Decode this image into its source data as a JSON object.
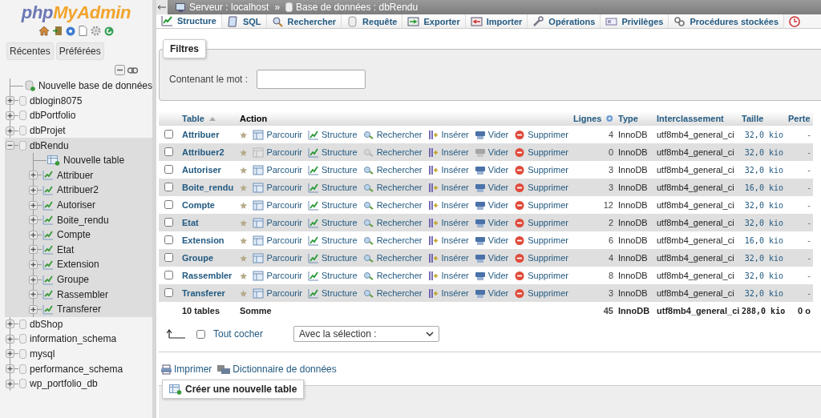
{
  "logo": [
    "php",
    "MyAdmin"
  ],
  "sidebar": {
    "tabs": [
      "Récentes",
      "Préférées"
    ],
    "tree": [
      {
        "label": "Nouvelle base de données",
        "kind": "new"
      },
      {
        "label": "dblogin8075",
        "kind": "db",
        "expanded": false,
        "selected": false
      },
      {
        "label": "dbPortfolio",
        "kind": "db",
        "expanded": false,
        "selected": false
      },
      {
        "label": "dbProjet",
        "kind": "db",
        "expanded": false,
        "selected": false
      },
      {
        "label": "dbRendu",
        "kind": "db",
        "expanded": true,
        "selected": true,
        "children": [
          {
            "label": "Nouvelle table",
            "kind": "new"
          },
          {
            "label": "Attribuer",
            "kind": "table",
            "expanded": false
          },
          {
            "label": "Attribuer2",
            "kind": "table",
            "expanded": false
          },
          {
            "label": "Autoriser",
            "kind": "table",
            "expanded": false
          },
          {
            "label": "Boite_rendu",
            "kind": "table",
            "expanded": false
          },
          {
            "label": "Compte",
            "kind": "table",
            "expanded": false
          },
          {
            "label": "Etat",
            "kind": "table",
            "expanded": false
          },
          {
            "label": "Extension",
            "kind": "table",
            "expanded": false
          },
          {
            "label": "Groupe",
            "kind": "table",
            "expanded": false
          },
          {
            "label": "Rassembler",
            "kind": "table",
            "expanded": false
          },
          {
            "label": "Transferer",
            "kind": "table",
            "expanded": false
          }
        ]
      },
      {
        "label": "dbShop",
        "kind": "db",
        "expanded": false,
        "selected": false
      },
      {
        "label": "information_schema",
        "kind": "db",
        "expanded": false,
        "selected": false
      },
      {
        "label": "mysql",
        "kind": "db",
        "expanded": false,
        "selected": false
      },
      {
        "label": "performance_schema",
        "kind": "db",
        "expanded": false,
        "selected": false
      },
      {
        "label": "wp_portfolio_db",
        "kind": "db",
        "expanded": false,
        "selected": false
      }
    ]
  },
  "breadcrumb": {
    "items": [
      "Serveur : localhost",
      "Base de données : dbRendu"
    ],
    "separator": "»"
  },
  "tabs": [
    {
      "label": "Structure",
      "selected": true
    },
    {
      "label": "SQL",
      "selected": false
    },
    {
      "label": "Rechercher",
      "selected": false
    },
    {
      "label": "Requête",
      "selected": false
    },
    {
      "label": "Exporter",
      "selected": false
    },
    {
      "label": "Importer",
      "selected": false
    },
    {
      "label": "Opérations",
      "selected": false
    },
    {
      "label": "Privilèges",
      "selected": false
    },
    {
      "label": "Procédures stockées",
      "selected": false
    }
  ],
  "filters": {
    "title": "Filtres",
    "label": "Contenant le mot :"
  },
  "table": {
    "columns": [
      "Table",
      "Action",
      "Lignes",
      "Type",
      "Interclassement",
      "Taille",
      "Perte"
    ],
    "rows": [
      {
        "name": "Attribuer",
        "checked": false,
        "empty": false,
        "actions": [
          "Parcourir",
          "Structure",
          "Rechercher",
          "Insérer",
          "Vider",
          "Supprimer"
        ],
        "rows": "4",
        "type": "InnoDB",
        "collation": "utf8mb4_general_ci",
        "size": "32,0 kio",
        "overhead": "-"
      },
      {
        "name": "Attribuer2",
        "checked": false,
        "empty": true,
        "actions": [
          "Parcourir",
          "Structure",
          "Rechercher",
          "Insérer",
          "Vider",
          "Supprimer"
        ],
        "rows": "0",
        "type": "InnoDB",
        "collation": "utf8mb4_general_ci",
        "size": "32,0 kio",
        "overhead": "-"
      },
      {
        "name": "Autoriser",
        "checked": false,
        "empty": false,
        "actions": [
          "Parcourir",
          "Structure",
          "Rechercher",
          "Insérer",
          "Vider",
          "Supprimer"
        ],
        "rows": "3",
        "type": "InnoDB",
        "collation": "utf8mb4_general_ci",
        "size": "32,0 kio",
        "overhead": "-"
      },
      {
        "name": "Boite_rendu",
        "checked": false,
        "empty": false,
        "actions": [
          "Parcourir",
          "Structure",
          "Rechercher",
          "Insérer",
          "Vider",
          "Supprimer"
        ],
        "rows": "3",
        "type": "InnoDB",
        "collation": "utf8mb4_general_ci",
        "size": "16,0 kio",
        "overhead": "-"
      },
      {
        "name": "Compte",
        "checked": false,
        "empty": false,
        "actions": [
          "Parcourir",
          "Structure",
          "Rechercher",
          "Insérer",
          "Vider",
          "Supprimer"
        ],
        "rows": "12",
        "type": "InnoDB",
        "collation": "utf8mb4_general_ci",
        "size": "32,0 kio",
        "overhead": "-"
      },
      {
        "name": "Etat",
        "checked": false,
        "empty": false,
        "actions": [
          "Parcourir",
          "Structure",
          "Rechercher",
          "Insérer",
          "Vider",
          "Supprimer"
        ],
        "rows": "2",
        "type": "InnoDB",
        "collation": "utf8mb4_general_ci",
        "size": "32,0 kio",
        "overhead": "-"
      },
      {
        "name": "Extension",
        "checked": false,
        "empty": false,
        "actions": [
          "Parcourir",
          "Structure",
          "Rechercher",
          "Insérer",
          "Vider",
          "Supprimer"
        ],
        "rows": "6",
        "type": "InnoDB",
        "collation": "utf8mb4_general_ci",
        "size": "16,0 kio",
        "overhead": "-"
      },
      {
        "name": "Groupe",
        "checked": false,
        "empty": false,
        "actions": [
          "Parcourir",
          "Structure",
          "Rechercher",
          "Insérer",
          "Vider",
          "Supprimer"
        ],
        "rows": "4",
        "type": "InnoDB",
        "collation": "utf8mb4_general_ci",
        "size": "32,0 kio",
        "overhead": "-"
      },
      {
        "name": "Rassembler",
        "checked": false,
        "empty": false,
        "actions": [
          "Parcourir",
          "Structure",
          "Rechercher",
          "Insérer",
          "Vider",
          "Supprimer"
        ],
        "rows": "8",
        "type": "InnoDB",
        "collation": "utf8mb4_general_ci",
        "size": "32,0 kio",
        "overhead": "-"
      },
      {
        "name": "Transferer",
        "checked": false,
        "empty": false,
        "actions": [
          "Parcourir",
          "Structure",
          "Rechercher",
          "Insérer",
          "Vider",
          "Supprimer"
        ],
        "rows": "3",
        "type": "InnoDB",
        "collation": "utf8mb4_general_ci",
        "size": "32,0 kio",
        "overhead": "-"
      }
    ],
    "footer": {
      "count": "10 tables",
      "label": "Somme",
      "rows": "45",
      "type": "InnoDB",
      "collation": "utf8mb4_general_ci",
      "size": "288,0 kio",
      "overhead": "0 o"
    }
  },
  "bulk": {
    "check_all": {
      "label": "Tout cocher",
      "checked": false
    },
    "selection": "Avec la sélection :"
  },
  "links": [
    "Imprimer",
    "Dictionnaire de données"
  ],
  "create_button": "Créer une nouvelle table"
}
